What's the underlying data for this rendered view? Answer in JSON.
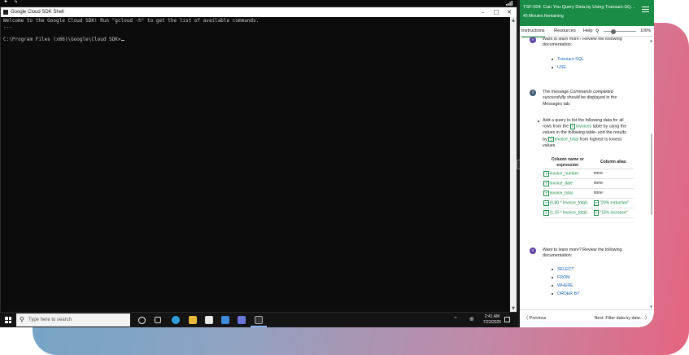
{
  "terminal": {
    "title": "Google Cloud SDK Shell",
    "lines": [
      "Welcome to the Google Cloud SDK! Run \"gcloud -h\" to get the list of available commands.",
      "---",
      "",
      "C:\\Program Files (x86)\\Google\\Cloud SDK>"
    ],
    "minimize_glyph": "–",
    "maximize_glyph": "□",
    "close_glyph": "✕"
  },
  "taskbar": {
    "search_placeholder": "Type here to search",
    "clock_time": "2:41 AM",
    "clock_date": "7/23/2025"
  },
  "panel": {
    "lab_title": "TSF-004: Can You Query Data by Using Transact-SQL...",
    "timer": "40 Minutes Remaining",
    "tabs": {
      "instructions": "Instructions",
      "resources": "Resources",
      "help": "Help"
    },
    "zoom_percent": "100%",
    "zoom_level": 0.3,
    "learn_more_1": "Want to learn more? Review the following documentation:",
    "links_1": [
      "Transact-SQL",
      "USE"
    ],
    "info_note_pre": "The message ",
    "info_note_em": "Commands completed successfully",
    "info_note_post": " should be displayed in the Messages tab.",
    "task": {
      "part1": "Add a query to list the following data for all rows from the ",
      "table_name": "invoices",
      "part2": " table by using the values in the following table- sort the results by ",
      "sort_col": "invoice_total",
      "part3": " from highest to lowest values."
    },
    "table": {
      "headers": [
        "Column name or expression",
        "Column alias"
      ],
      "rows": [
        {
          "expr": "invoice_number",
          "alias": "none"
        },
        {
          "expr": "invoice_date",
          "alias": "none"
        },
        {
          "expr": "invoice_total",
          "alias": "none"
        },
        {
          "expr": "(0.80 * invoice_total)",
          "alias": "\"20% reduction\""
        },
        {
          "expr": "(1.15 * invoice_total)",
          "alias": "\"15% increase\""
        }
      ]
    },
    "learn_more_2": "Want to learn more? Review the following documentation:",
    "links_2": [
      "SELECT",
      "FROM",
      "WHERE",
      "ORDER BY"
    ],
    "footer": {
      "previous": "Previous",
      "next": "Next: Filter data by date..."
    }
  },
  "colors": {
    "header_green": "#1a8c46",
    "link_blue": "#1565c0",
    "terminal_bg": "#0c0c0c"
  }
}
